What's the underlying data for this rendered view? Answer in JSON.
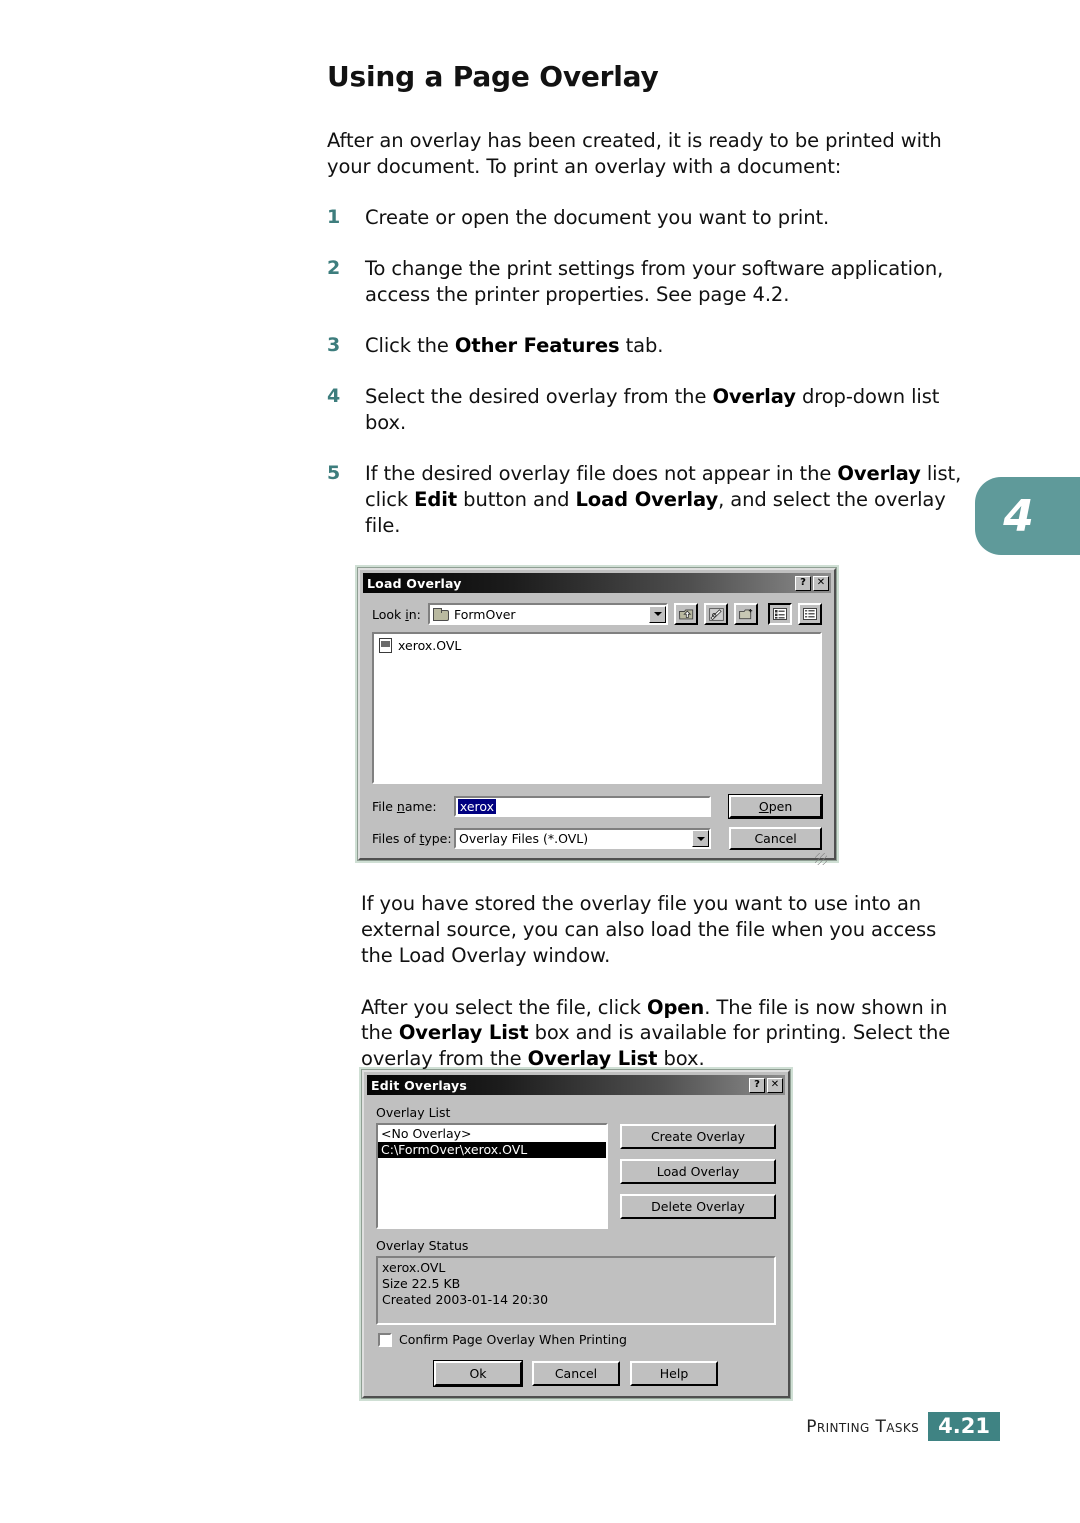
{
  "page": {
    "title": "Using a Page Overlay",
    "intro": "After an overlay has been created, it is ready to be printed with your document. To print an overlay with a document:",
    "chapter_tab": "4",
    "accent_teal": "#5f9a9a",
    "footer": {
      "label": "Printing Tasks",
      "page_number": "4.21",
      "badge_color": "#3f8383"
    }
  },
  "steps": [
    {
      "num": "1",
      "text": "Create or open the document you want to print."
    },
    {
      "num": "2",
      "text": "To change the print settings from your software application, access the printer properties. See page 4.2."
    },
    {
      "num": "3",
      "text": "Click the Other Features tab."
    },
    {
      "num": "4",
      "text": "Select the desired overlay from the Overlay drop-down list box."
    },
    {
      "num": "5",
      "text": "If the desired overlay file does not appear in the Overlay list, click Edit button and Load Overlay, and select the overlay file."
    }
  ],
  "body_paragraphs": {
    "after_load_dialog_1": "If you have stored the overlay file you want to use into an external source, you can also load the file when you access the Load Overlay window.",
    "after_load_dialog_2": "After you select the file, click Open. The file is now shown in the Overlay List box and is available for printing. Select the overlay from the Overlay List box."
  },
  "load_overlay_dialog": {
    "title": "Load Overlay",
    "help_button": "?",
    "close_button": "✕",
    "look_in_label": "Look in:",
    "look_in_value": "FormOver",
    "toolbar": [
      {
        "name": "up-one-level-icon",
        "label": "Up One Level"
      },
      {
        "name": "favorites-icon",
        "label": "Favorites"
      },
      {
        "name": "new-folder-icon",
        "label": "Create New Folder"
      },
      {
        "name": "list-view-icon",
        "label": "List"
      },
      {
        "name": "details-view-icon",
        "label": "Details"
      }
    ],
    "files": [
      {
        "name": "xerox.OVL"
      }
    ],
    "file_name_label": "File name:",
    "file_name_value": "xerox",
    "files_of_type_label": "Files of type:",
    "files_of_type_value": "Overlay Files (*.OVL)",
    "open_button": "Open",
    "cancel_button": "Cancel"
  },
  "edit_overlays_dialog": {
    "title": "Edit Overlays",
    "help_button": "?",
    "close_button": "✕",
    "overlay_list_label": "Overlay List",
    "overlay_list_items": [
      {
        "text": "<No Overlay>",
        "selected": false
      },
      {
        "text": "C:\\FormOver\\xerox.OVL",
        "selected": true
      }
    ],
    "buttons": {
      "create_overlay": "Create Overlay",
      "load_overlay": "Load Overlay",
      "delete_overlay": "Delete Overlay"
    },
    "overlay_status_label": "Overlay Status",
    "status_lines": [
      "xerox.OVL",
      "Size 22.5 KB",
      "Created 2003-01-14 20:30"
    ],
    "confirm_checkbox_label": "Confirm Page Overlay When Printing",
    "confirm_checkbox_checked": false,
    "ok_button": "Ok",
    "cancel_button": "Cancel",
    "help_label": "Help"
  }
}
